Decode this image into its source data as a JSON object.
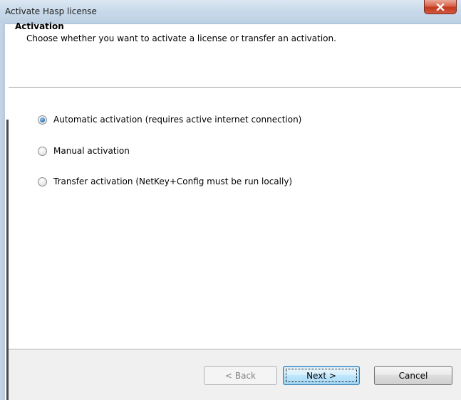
{
  "window": {
    "title": "Activate Hasp license"
  },
  "header": {
    "title": "Activation",
    "description": "Choose whether you want to activate a license or transfer an activation."
  },
  "options": [
    {
      "label": "Automatic activation (requires active internet connection)",
      "checked": true
    },
    {
      "label": "Manual activation",
      "checked": false
    },
    {
      "label": "Transfer activation (NetKey+Config must be run locally)",
      "checked": false
    }
  ],
  "buttons": {
    "back": "< Back",
    "next": "Next >",
    "cancel": "Cancel"
  },
  "icons": {
    "close": "close-icon"
  },
  "colors": {
    "accent_radio": "#2d78c4",
    "close_button": "#c2391f",
    "footer_bg": "#f0f0f0"
  }
}
